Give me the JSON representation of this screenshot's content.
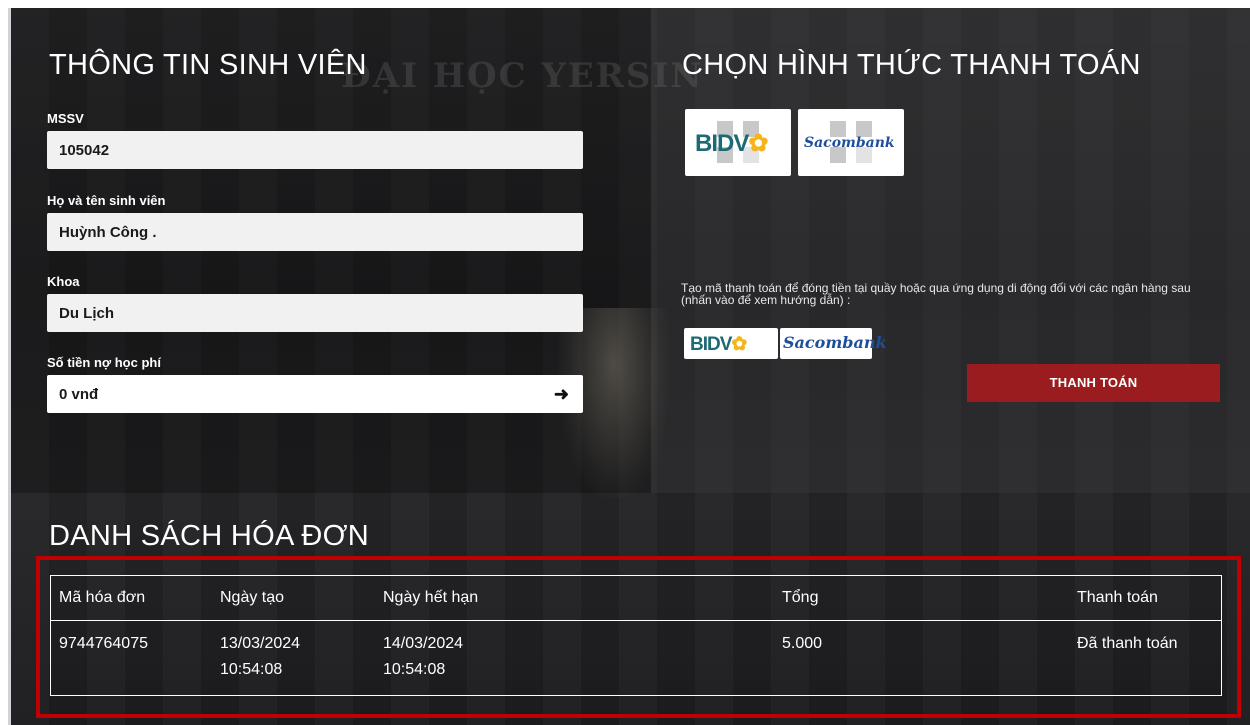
{
  "student": {
    "title": "THÔNG TIN SINH VIÊN",
    "mssv_label": "MSSV",
    "mssv_value": "105042",
    "name_label": "Họ và tên sinh viên",
    "name_value": "Huỳnh Công .",
    "faculty_label": "Khoa",
    "faculty_value": "Du Lịch",
    "debt_label": "Số tiền nợ học phí",
    "debt_value": "0 vnđ",
    "debt_arrow": "➜"
  },
  "payment": {
    "title": "CHỌN HÌNH THỨC THANH TOÁN",
    "bank_bidv": "BIDV",
    "bank_sacombank": "Sacombank",
    "note": "Tạo mã thanh toán để đóng tiền tại quầy hoặc qua ứng dụng di động đối với các ngân hàng sau (nhấn vào để xem hướng dẫn) :",
    "pay_button": "THANH TOÁN"
  },
  "invoices": {
    "title": "DANH SÁCH HÓA ĐƠN",
    "columns": [
      "Mã hóa đơn",
      "Ngày tạo",
      "Ngày hết hạn",
      "Tổng",
      "Thanh toán"
    ],
    "rows": [
      {
        "id": "9744764075",
        "created_date": "13/03/2024",
        "created_time": "10:54:08",
        "expiry_date": "14/03/2024",
        "expiry_time": "10:54:08",
        "total": "5.000",
        "status": "Đã thanh toán"
      }
    ]
  },
  "colors": {
    "accent_red": "#9b1c1f",
    "highlight_red": "#c00000",
    "bidv_teal": "#1b6a74",
    "sacombank_blue": "#1f4e9c"
  }
}
